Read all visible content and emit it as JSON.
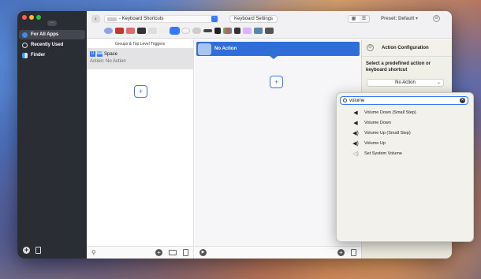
{
  "sidebar": {
    "more_label": "...",
    "items": [
      {
        "label": "For All Apps",
        "icon": "globe-icon",
        "selected": true
      },
      {
        "label": "Recently Used",
        "icon": "clock-icon",
        "selected": false
      },
      {
        "label": "Finder",
        "icon": "finder-icon",
        "selected": false
      }
    ]
  },
  "toolbar": {
    "back_glyph": "‹",
    "path_label": "- Keyboard Shortcuts",
    "path_chevron": "⌃",
    "keyboard_settings_label": "Keyboard Settings",
    "preset_label": "Preset: Default",
    "preset_chevron": "▾",
    "view_grid_glyph": "▦",
    "view_list_glyph": "☰",
    "minus_glyph": "⊖"
  },
  "groups": {
    "header": "Groups & Top Level Triggers",
    "row": {
      "title": "Space",
      "subtitle": "Action: No Action",
      "tag1": "U",
      "tag2": "⌨"
    },
    "add_glyph": "+"
  },
  "actions": {
    "row_label": "No Action",
    "add_glyph": "+"
  },
  "config": {
    "title": "Action Configuration",
    "prompt": "Select a predefined action or keyboard shortcut",
    "select_value": "No Action",
    "select_chevron": "⌄"
  },
  "popover": {
    "search_value": "volume",
    "clear_glyph": "✕",
    "results": [
      {
        "label": "Volume Down (Small Step)",
        "icon": "speaker-low-icon",
        "glyph": "◀"
      },
      {
        "label": "Volume Down",
        "icon": "speaker-low-icon",
        "glyph": "◀"
      },
      {
        "label": "Volume Up (Small Step)",
        "icon": "speaker-high-icon",
        "glyph": "◀)"
      },
      {
        "label": "Volume Up",
        "icon": "speaker-high-icon",
        "glyph": "◀)"
      },
      {
        "label": "Set System Volume",
        "icon": "speaker-outline-icon",
        "glyph": "◁)"
      }
    ]
  },
  "footer": {
    "plus_glyph": "+",
    "play_glyph": "▶",
    "search_glyph": "⚲"
  },
  "colors": {
    "accent": "#3478f6",
    "selection": "#2f6ed6",
    "sidebar": "#2b2d35"
  }
}
